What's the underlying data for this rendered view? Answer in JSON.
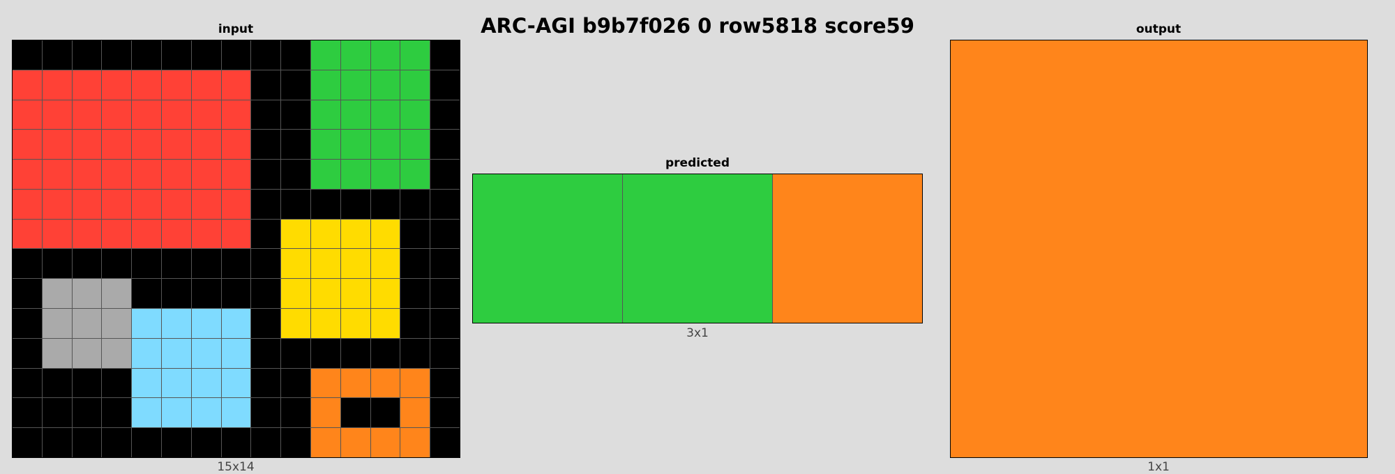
{
  "title": "ARC-AGI b9b7f026 0 row5818 score59",
  "palette": {
    "0": "#000000",
    "1": "#0074D9",
    "2": "#FF4136",
    "3": "#2ECC40",
    "4": "#FFDC00",
    "5": "#AAAAAA",
    "6": "#F012BE",
    "7": "#FF851B",
    "8": "#7FDBFF",
    "9": "#870C25"
  },
  "panels": [
    {
      "id": "input",
      "label": "input",
      "dims": "15x14",
      "grid": [
        [
          0,
          0,
          0,
          0,
          0,
          0,
          0,
          0,
          0,
          0,
          3,
          3,
          3,
          3,
          0
        ],
        [
          2,
          2,
          2,
          2,
          2,
          2,
          2,
          2,
          0,
          0,
          3,
          3,
          3,
          3,
          0
        ],
        [
          2,
          2,
          2,
          2,
          2,
          2,
          2,
          2,
          0,
          0,
          3,
          3,
          3,
          3,
          0
        ],
        [
          2,
          2,
          2,
          2,
          2,
          2,
          2,
          2,
          0,
          0,
          3,
          3,
          3,
          3,
          0
        ],
        [
          2,
          2,
          2,
          2,
          2,
          2,
          2,
          2,
          0,
          0,
          3,
          3,
          3,
          3,
          0
        ],
        [
          2,
          2,
          2,
          2,
          2,
          2,
          2,
          2,
          0,
          0,
          0,
          0,
          0,
          0,
          0
        ],
        [
          2,
          2,
          2,
          2,
          2,
          2,
          2,
          2,
          0,
          4,
          4,
          4,
          4,
          0,
          0
        ],
        [
          0,
          0,
          0,
          0,
          0,
          0,
          0,
          0,
          0,
          4,
          4,
          4,
          4,
          0,
          0
        ],
        [
          0,
          5,
          5,
          5,
          0,
          0,
          0,
          0,
          0,
          4,
          4,
          4,
          4,
          0,
          0
        ],
        [
          0,
          5,
          5,
          5,
          8,
          8,
          8,
          8,
          0,
          4,
          4,
          4,
          4,
          0,
          0
        ],
        [
          0,
          5,
          5,
          5,
          8,
          8,
          8,
          8,
          0,
          0,
          0,
          0,
          0,
          0,
          0
        ],
        [
          0,
          0,
          0,
          0,
          8,
          8,
          8,
          8,
          0,
          0,
          7,
          7,
          7,
          7,
          0
        ],
        [
          0,
          0,
          0,
          0,
          8,
          8,
          8,
          8,
          0,
          0,
          7,
          0,
          0,
          7,
          0
        ],
        [
          0,
          0,
          0,
          0,
          0,
          0,
          0,
          0,
          0,
          0,
          7,
          7,
          7,
          7,
          0
        ]
      ]
    },
    {
      "id": "predicted",
      "label": "predicted",
      "dims": "3x1",
      "grid": [
        [
          3,
          3,
          7
        ]
      ]
    },
    {
      "id": "output",
      "label": "output",
      "dims": "1x1",
      "grid": [
        [
          7
        ]
      ]
    }
  ]
}
